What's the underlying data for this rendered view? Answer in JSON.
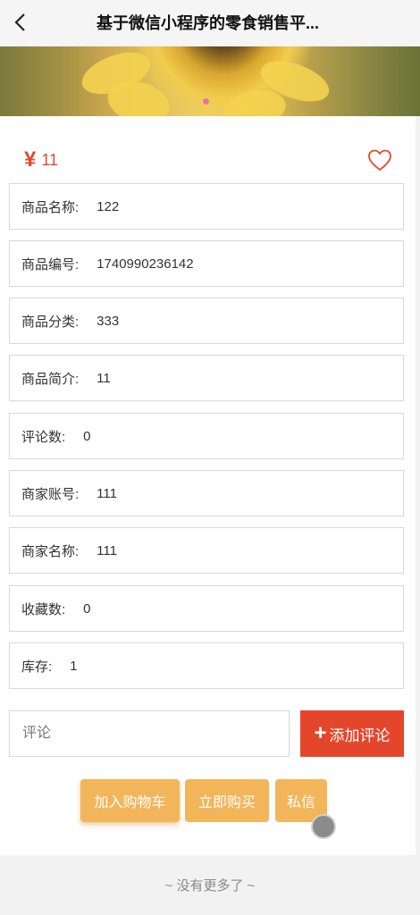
{
  "header": {
    "title": "基于微信小程序的零食销售平..."
  },
  "product": {
    "currency_symbol": "¥",
    "price": "11"
  },
  "details": [
    {
      "label": "商品名称:",
      "value": "122"
    },
    {
      "label": "商品编号:",
      "value": "1740990236142"
    },
    {
      "label": "商品分类:",
      "value": "333"
    },
    {
      "label": "商品简介:",
      "value": "11"
    },
    {
      "label": "评论数:",
      "value": "0"
    },
    {
      "label": "商家账号:",
      "value": "111"
    },
    {
      "label": "商家名称:",
      "value": "111"
    },
    {
      "label": "收藏数:",
      "value": "0"
    },
    {
      "label": "库存:",
      "value": "1"
    }
  ],
  "comment": {
    "placeholder": "评论",
    "add_plus": "+",
    "add_label": "添加评论"
  },
  "actions": {
    "cart": "加入购物车",
    "buy": "立即购买",
    "message": "私信"
  },
  "footer": {
    "text": "~ 没有更多了 ~"
  },
  "colors": {
    "accent_red": "#e4462c",
    "button_orange": "#f3b55a"
  },
  "icons": {
    "back": "chevron-left-icon",
    "favorite": "heart-outline-icon"
  }
}
